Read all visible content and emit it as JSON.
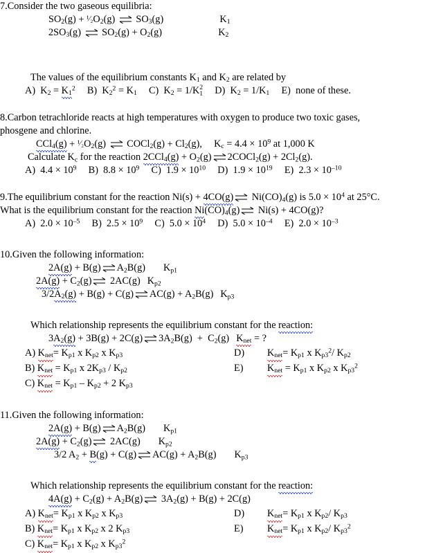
{
  "document": {
    "type": "chemistry-worksheet",
    "topic": "Equilibrium constants",
    "colors": {
      "text": "#000000",
      "background": "#ffffff",
      "spellcheck_red": "#e03030",
      "grammar_blue": "#3050d8"
    }
  },
  "q7": {
    "number": "7.",
    "stem": "Consider the two gaseous equilibria:",
    "reactions": [
      {
        "left_1": "SO",
        "left_1_sub": "2",
        "left_1_state": "(g)",
        "plus": "+",
        "left_2_coef": "¹⁄₂",
        "left_2": "O",
        "left_2_sub": "2",
        "left_2_state": "(g)",
        "right_1": "SO",
        "right_1_sub": "3",
        "right_1_state": "(g)",
        "constant": "K",
        "constant_sub": "1"
      },
      {
        "left_coef": "2",
        "left_1": "SO",
        "left_1_sub": "3",
        "left_1_state": "(g)",
        "right_1": "SO",
        "right_1_sub": "2",
        "right_1_state": "(g)",
        "plus": "+",
        "right_2": "O",
        "right_2_sub": "2",
        "right_2_state": "(g)",
        "constant": "K",
        "constant_sub": "2"
      }
    ],
    "prompt_a": "The values of the equilibrium constants K",
    "prompt_sub1": "1",
    "prompt_b": " and K",
    "prompt_sub2": "2",
    "prompt_c": " are related by",
    "choices": {
      "a_label": "A)",
      "a_lhs": "K",
      "a_lhs_sub": "2",
      "a_eq": "=",
      "a_rhs": "K",
      "a_rhs_sub": "1",
      "a_rhs_sup": "2",
      "b_label": "B)",
      "b_lhs": "K",
      "b_lhs_sub": "2",
      "b_lhs_sup": "2",
      "b_eq": "=",
      "b_rhs": "K",
      "b_rhs_sub": "1",
      "c_label": "C)",
      "c_lhs": "K",
      "c_lhs_sub": "2",
      "c_eq": "=",
      "c_rhs": "1/K",
      "c_rhs_stack_up": "2",
      "c_rhs_stack_dn": "1",
      "d_label": "D)",
      "d_lhs": "K",
      "d_lhs_sub": "2",
      "d_eq": "=",
      "d_rhs": "1/K",
      "d_rhs_sub": "1",
      "e_label": "E)",
      "e_text": "none of these."
    }
  },
  "q8": {
    "number": "8.",
    "stem_line1": "Carbon tetrachloride reacts at high temperatures with oxygen to produce two toxic gases,",
    "stem_line2": "phosgene and chlorine.",
    "reaction": {
      "r1": "CCl",
      "r1_sub": "4",
      "r1_state": "(g)",
      "plus1": "+",
      "r2_coef": "¹⁄₂",
      "r2": "O",
      "r2_sub": "2",
      "r2_state": "(g)",
      "p1": "COCl",
      "p1_sub": "2",
      "p1_state": "(g)",
      "plus2": "+",
      "p2": "Cl",
      "p2_sub": "2",
      "p2_state": "(g),",
      "kc": "K",
      "kc_sub": "c",
      "kc_eq": "= 4.4",
      "times": "×",
      "base": "10",
      "exp": "9",
      "cond": "at 1,000 K"
    },
    "calc_line": {
      "pre": "Calculate K",
      "pre_sub": "c",
      "mid": " for the reaction ",
      "r1_coef": "2",
      "r1": "CCl",
      "r1_sub": "4",
      "r1_state": "(g)",
      "plus1": "+",
      "r2": "O",
      "r2_sub": "2",
      "r2_state": "(g)",
      "p1_coef": "2",
      "p1": "COCl",
      "p1_sub": "2",
      "p1_state": "(g)",
      "plus2": "+",
      "p2_coef": "2",
      "p2": "Cl",
      "p2_sub": "2",
      "p2_state": "(g)."
    },
    "choices": [
      {
        "label": "A)",
        "mantissa": "4.4",
        "times": "×",
        "base": "10",
        "exp": "9"
      },
      {
        "label": "B)",
        "mantissa": "8.8",
        "times": "×",
        "base": "10",
        "exp": "9"
      },
      {
        "label": "C)",
        "mantissa": "1.9",
        "times": "×",
        "base": "10",
        "exp": "10"
      },
      {
        "label": "D)",
        "mantissa": "1.9",
        "times": "×",
        "base": "10",
        "exp": "19"
      },
      {
        "label": "E)",
        "mantissa": "2.3",
        "times": "×",
        "base": "10",
        "exp": "–10"
      }
    ]
  },
  "q9": {
    "number": "9.",
    "line1": {
      "pre": "The equilibrium constant for the reaction Ni(s) + ",
      "reactant": "4CO",
      "reactant_state": "(g)",
      "product": "Ni(CO)",
      "product_sub": "4",
      "product_state": "(g)",
      "post": " is 5.0 × 10",
      "post_exp": "4",
      "post_tail": " at 25°C."
    },
    "line2": {
      "pre": "What is the equilibrium constant for the reaction ",
      "reactant": "Ni",
      "reactant_rest": "(CO)",
      "reactant_sub": "4",
      "reactant_state": "(g)",
      "product": "Ni(s) + 4CO(g)?"
    },
    "choices": [
      {
        "label": "A)",
        "mantissa": "2.0",
        "times": "×",
        "base": "10",
        "exp": "–5"
      },
      {
        "label": "B)",
        "mantissa": "2.5",
        "times": "×",
        "base": "10",
        "exp": "9"
      },
      {
        "label": "C)",
        "mantissa": "5.0",
        "times": "×",
        "base": "10",
        "exp": "4"
      },
      {
        "label": "D)",
        "mantissa": "5.0",
        "times": "×",
        "base": "10",
        "exp": "–4"
      },
      {
        "label": "E)",
        "mantissa": "2.0",
        "times": "×",
        "base": "10",
        "exp": "–3"
      }
    ]
  },
  "q10": {
    "number": "10.",
    "stem": "Given the following information:",
    "given": [
      {
        "left": "2A",
        "left_state": "(g)",
        "plus": "+ B(g)",
        "right": "A",
        "right_sub": "2",
        "right_rest": "B(g)",
        "k": "K",
        "k_sub": "p1"
      },
      {
        "left": "2A",
        "left_state": "(g)",
        "plus": "+ C",
        "plus_sub": "2",
        "plus_state": "(g)",
        "right": "2AC(g)",
        "k": "K",
        "k_sub": "p2"
      },
      {
        "left": "3/2",
        "left_sp": "A",
        "left_sub": "2",
        "left_state": "(g)",
        "plus": "+ B(g) + C(g)",
        "right": "AC(g) + A",
        "right_sub": "2",
        "right_rest": "B(g)",
        "k": "K",
        "k_sub": "p3"
      }
    ],
    "prompt": "Which relationship represents the equilibrium constant for the ",
    "prompt_word": "reaction:",
    "target": {
      "left_coef": "3",
      "left": "A",
      "left_sub": "2",
      "left_state": "(g)",
      "rest_left": "+ 3B(g) + 2C(g)",
      "right": "3A",
      "right_sub": "2",
      "right_rest": "B(g)",
      "plus": "+",
      "right2": "C",
      "right2_sub": "2",
      "right2_state": "(g)",
      "knet": "K",
      "knet_sub": "net",
      "question": "= ?"
    },
    "choices": {
      "a": {
        "label": "A)",
        "k": "K",
        "k_sub": "net",
        "eq": "= K",
        "t1_sub": "p1",
        "x1": " x K",
        "t2_sub": "p2",
        "x2": " x K",
        "t3_sub": "p3"
      },
      "b": {
        "label": "B)",
        "k": "K",
        "k_sub": "net",
        "eq": "= K",
        "t1_sub": "p1",
        "x1": " x 2K",
        "t2_sub": "p3",
        "x2": " / K",
        "t3_sub": "p2"
      },
      "c": {
        "label": "C)",
        "k": "K",
        "k_sub": "net",
        "eq": "= K",
        "t1_sub": "p1",
        "x1": " – K",
        "t2_sub": "p2",
        "x2": " + 2 K",
        "t3_sub": "p3"
      },
      "d": {
        "label": "D)",
        "k": "K",
        "k_sub": "net",
        "eq": "= K",
        "t1_sub": "p1",
        "x1": " x K",
        "t2_sub": "p3",
        "t2_sup": "2",
        "x2": "/ K",
        "t3_sub": "p2"
      },
      "e": {
        "label": "E)",
        "k": "K",
        "k_sub": "net",
        "eq": "= K",
        "t1_sub": "p1",
        "x1": " x K",
        "t2_sub": "p2",
        "x2": " x K",
        "t3_sub": "p3",
        "t3_sup": "2"
      }
    }
  },
  "q11": {
    "number": "11.",
    "stem": "Given the following information:",
    "given": [
      {
        "left": "2A",
        "left_state": "(g)",
        "plus": "+ B(g)",
        "right": "A",
        "right_sub": "2",
        "right_rest": "B(g)",
        "k": "K",
        "k_sub": "p1"
      },
      {
        "left": "2A",
        "left_state": "(g)",
        "plus": "+ C",
        "plus_sub": "2",
        "plus_state": "(g)",
        "right": "2AC(g)",
        "k": "K",
        "k_sub": "p2"
      },
      {
        "left": "3/2 A",
        "left_sub": "2",
        "plus_pre": "+ ",
        "plus_word": "B",
        "plus_rest": "(g) + C(g)",
        "right": "AC(g) + A",
        "right_sub": "2",
        "right_rest": "B(g)",
        "k": "K",
        "k_sub": "p3"
      }
    ],
    "prompt": "Which relationship represents the equilibrium constant for the ",
    "prompt_word": "reaction:",
    "target": {
      "left": "4A",
      "left_state": "(g)",
      "rest_left_pre": "+ C",
      "rest_left_sub": "2",
      "rest_left_mid": "(g) + A",
      "rest_left_sub2": "2",
      "rest_left_post": "B(g)",
      "right_coef": "3",
      "right": "A",
      "right_sub": "2",
      "right_rest": "(g) + B(g) + 2C(g)"
    },
    "choices": {
      "a": {
        "label": "A)",
        "k": "K",
        "k_sub": "net",
        "eq": "= K",
        "t1_sub": "p1",
        "x1": " x K",
        "t2_sub": "p2",
        "x2": " x K",
        "t3_sub": "p3"
      },
      "b": {
        "label": "B)",
        "k": "K",
        "k_sub": "net",
        "eq": "= K",
        "t1_sub": "p1",
        "x1": " x K",
        "t2_sub": "p2",
        "x2": " x 2 K",
        "t3_sub": "p3"
      },
      "c": {
        "label": "C)",
        "k": "K",
        "k_sub": "net",
        "eq": "= K",
        "t1_sub": "p1",
        "x1": " x K",
        "t2_sub": "p2",
        "x2": " x K",
        "t3_sub": "p3",
        "t3_sup": "2"
      },
      "d": {
        "label": "D)",
        "k": "K",
        "k_sub": "net",
        "eq": "= K",
        "t1_sub": "p1",
        "x1": " x K",
        "t2_sub": "p2",
        "x2": "/ K",
        "t3_sub": "p3"
      },
      "e": {
        "label": "E)",
        "k": "K",
        "k_sub": "net",
        "eq": "= K",
        "t1_sub": "p1",
        "x1": " x K",
        "t2_sub": "p2",
        "x2": "/ K",
        "t3_sub": "p3",
        "t3_sup": "2"
      }
    }
  }
}
